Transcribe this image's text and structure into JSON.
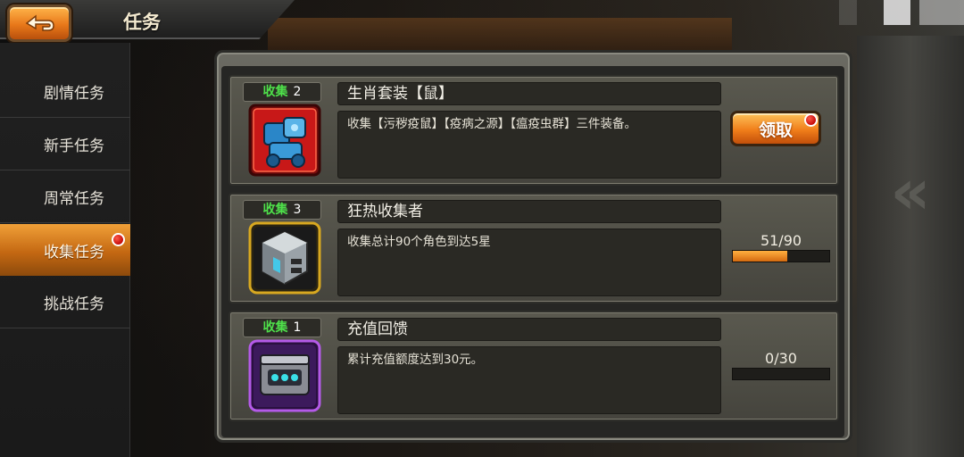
{
  "header": {
    "title": "任务",
    "back_icon": "return-arrow-icon"
  },
  "sidebar": {
    "items": [
      {
        "label": "剧情任务",
        "active": false
      },
      {
        "label": "新手任务",
        "active": false
      },
      {
        "label": "周常任务",
        "active": false
      },
      {
        "label": "收集任务",
        "active": true,
        "badge": true
      },
      {
        "label": "挑战任务",
        "active": false
      }
    ]
  },
  "tasks": [
    {
      "tag_label": "收集",
      "tag_count": "2",
      "title": "生肖套装【鼠】",
      "description": "收集【污秽疫鼠】【疫病之源】【瘟疫虫群】三件装备。",
      "icon": "mech-armor-set-icon",
      "action": {
        "type": "claim",
        "label": "领取",
        "badge": true
      }
    },
    {
      "tag_label": "收集",
      "tag_count": "3",
      "title": "狂热收集者",
      "description": "收集总计90个角色到达5星",
      "icon": "silver-cube-icon",
      "progress": {
        "text": "51/90",
        "current": 51,
        "total": 90
      }
    },
    {
      "tag_label": "收集",
      "tag_count": "1",
      "title": "充值回馈",
      "description": "累计充值额度达到30元。",
      "icon": "purple-crate-icon",
      "progress": {
        "text": "0/30",
        "current": 0,
        "total": 30
      }
    }
  ],
  "colors": {
    "accent_orange": "#f07e1a",
    "tag_green": "#4ee04a",
    "badge_red": "#c40a0a"
  }
}
